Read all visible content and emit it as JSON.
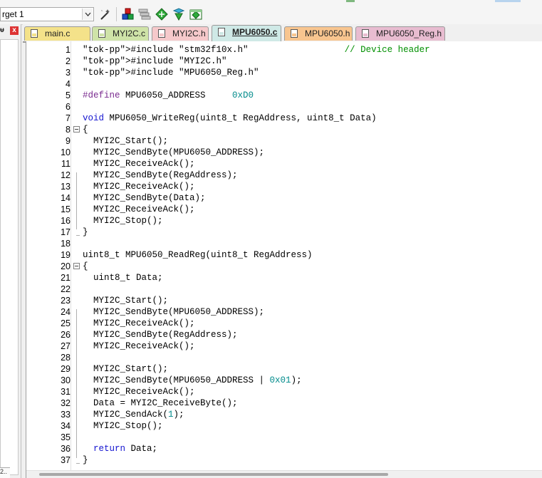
{
  "toolbar": {
    "target_value": "rget 1",
    "icons": [
      "dropdown-arrow-icon",
      "magic-wand-icon",
      "manage-components-icon",
      "packs-icon",
      "select-pack-icon",
      "batch-setup-icon",
      "configure-icon"
    ]
  },
  "left_panel": {
    "pin": "ᵾ",
    "close": "x",
    "bottom_tab": "2.."
  },
  "tabs": [
    {
      "label": "main.c",
      "color": "#f4e28a",
      "active": false
    },
    {
      "label": "MYI2C.c",
      "color": "#cfe3a8",
      "active": false
    },
    {
      "label": "MYI2C.h",
      "color": "#f6c9cb",
      "active": false
    },
    {
      "label": "MPU6050.c",
      "color": "#cfe9e6",
      "active": true
    },
    {
      "label": "MPU6050.h",
      "color": "#f8c58f",
      "active": false
    },
    {
      "label": "MPU6050_Reg.h",
      "color": "#e8bcd0",
      "active": false
    }
  ],
  "editor": {
    "lines": [
      {
        "n": "1",
        "text": "#include \"stm32f10x.h\"                  // Device header"
      },
      {
        "n": "2",
        "text": "#include \"MYI2C.h\""
      },
      {
        "n": "3",
        "text": "#include \"MPU6050_Reg.h\""
      },
      {
        "n": "4",
        "text": ""
      },
      {
        "n": "5",
        "text": "#define MPU6050_ADDRESS     0xD0"
      },
      {
        "n": "6",
        "text": ""
      },
      {
        "n": "7",
        "text": "void MPU6050_WriteReg(uint8_t RegAddress, uint8_t Data)"
      },
      {
        "n": "8",
        "text": "{"
      },
      {
        "n": "9",
        "text": "  MYI2C_Start();"
      },
      {
        "n": "10",
        "text": "  MYI2C_SendByte(MPU6050_ADDRESS);"
      },
      {
        "n": "11",
        "text": "  MYI2C_ReceiveAck();"
      },
      {
        "n": "12",
        "text": "  MYI2C_SendByte(RegAddress);"
      },
      {
        "n": "13",
        "text": "  MYI2C_ReceiveAck();"
      },
      {
        "n": "14",
        "text": "  MYI2C_SendByte(Data);"
      },
      {
        "n": "15",
        "text": "  MYI2C_ReceiveAck();"
      },
      {
        "n": "16",
        "text": "  MYI2C_Stop();"
      },
      {
        "n": "17",
        "text": "}"
      },
      {
        "n": "18",
        "text": ""
      },
      {
        "n": "19",
        "text": "uint8_t MPU6050_ReadReg(uint8_t RegAddress)"
      },
      {
        "n": "20",
        "text": "{"
      },
      {
        "n": "21",
        "text": "  uint8_t Data;"
      },
      {
        "n": "22",
        "text": ""
      },
      {
        "n": "23",
        "text": "  MYI2C_Start();"
      },
      {
        "n": "24",
        "text": "  MYI2C_SendByte(MPU6050_ADDRESS);"
      },
      {
        "n": "25",
        "text": "  MYI2C_ReceiveAck();"
      },
      {
        "n": "26",
        "text": "  MYI2C_SendByte(RegAddress);"
      },
      {
        "n": "27",
        "text": "  MYI2C_ReceiveAck();"
      },
      {
        "n": "28",
        "text": ""
      },
      {
        "n": "29",
        "text": "  MYI2C_Start();"
      },
      {
        "n": "30",
        "text": "  MYI2C_SendByte(MPU6050_ADDRESS | 0x01);"
      },
      {
        "n": "31",
        "text": "  MYI2C_ReceiveAck();"
      },
      {
        "n": "32",
        "text": "  Data = MYI2C_ReceiveByte();"
      },
      {
        "n": "33",
        "text": "  MYI2C_SendAck(1);"
      },
      {
        "n": "34",
        "text": "  MYI2C_Stop();"
      },
      {
        "n": "35",
        "text": ""
      },
      {
        "n": "36",
        "text": "  return Data;"
      },
      {
        "n": "37",
        "text": "}"
      }
    ]
  }
}
